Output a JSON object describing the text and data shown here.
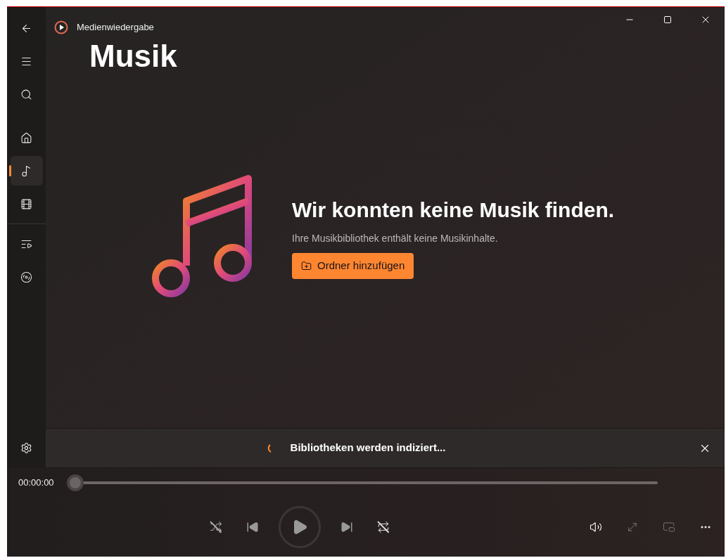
{
  "app_title": "Medienwiedergabe",
  "page_title": "Musik",
  "nav": [
    {
      "kind": "back",
      "selected": false
    },
    {
      "kind": "menu",
      "selected": false
    },
    {
      "kind": "search",
      "selected": false
    },
    {
      "kind": "home",
      "selected": false
    },
    {
      "kind": "music",
      "selected": true
    },
    {
      "kind": "video",
      "selected": false
    },
    {
      "kind": "queue",
      "selected": false
    },
    {
      "kind": "playlists",
      "selected": false
    }
  ],
  "empty_state": {
    "title": "Wir konnten keine Musik finden.",
    "message": "Ihre Musikbibliothek enthält keine Musikinhalte.",
    "button": "Ordner hinzufügen"
  },
  "notification": {
    "text": "Bibliotheken werden indiziert..."
  },
  "player": {
    "time": "00:00:00",
    "level": 0,
    "shuffle": false,
    "repeat": false
  }
}
